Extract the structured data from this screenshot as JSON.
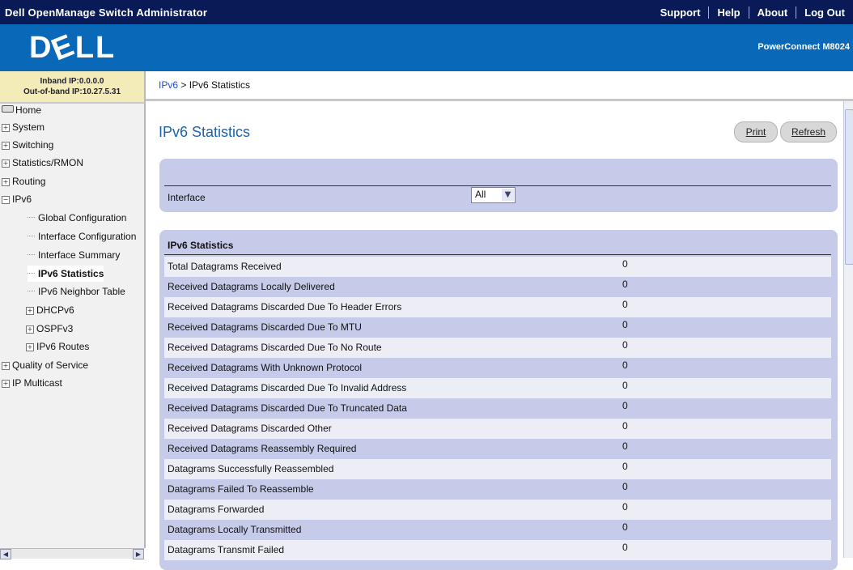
{
  "topbar": {
    "title": "Dell OpenManage Switch Administrator",
    "links": [
      "Support",
      "Help",
      "About",
      "Log Out"
    ]
  },
  "header": {
    "logo_left": "D",
    "logo_mid": "E",
    "logo_right": "LL",
    "product": "PowerConnect M8024"
  },
  "ipinfo": {
    "inband": "Inband IP:0.0.0.0",
    "outband": "Out-of-band IP:10.27.5.31"
  },
  "nav": {
    "home": "Home",
    "system": "System",
    "switching": "Switching",
    "statistics": "Statistics/RMON",
    "routing": "Routing",
    "ipv6": "IPv6",
    "global": "Global Configuration",
    "interface_cfg": "Interface Configuration",
    "interface_summary": "Interface Summary",
    "ipv6_statistics": "IPv6 Statistics",
    "neighbor": "IPv6 Neighbor Table",
    "dhcpv6": "DHCPv6",
    "ospfv3": "OSPFv3",
    "routes": "IPv6 Routes",
    "qos": "Quality of Service",
    "multicast": "IP Multicast"
  },
  "breadcrumb": {
    "link": "IPv6",
    "separator": " > ",
    "current": "IPv6 Statistics"
  },
  "main": {
    "title": "IPv6 Statistics",
    "print": "Print",
    "refresh": "Refresh",
    "interface_label": "Interface",
    "interface_value": "All",
    "stats_heading": "IPv6 Statistics"
  },
  "stats": [
    {
      "label": "Total Datagrams Received",
      "value": "0"
    },
    {
      "label": "Received Datagrams Locally Delivered",
      "value": "0"
    },
    {
      "label": "Received Datagrams Discarded Due To Header Errors",
      "value": "0"
    },
    {
      "label": "Received Datagrams Discarded Due To MTU",
      "value": "0"
    },
    {
      "label": "Received Datagrams Discarded Due To No Route",
      "value": "0"
    },
    {
      "label": "Received Datagrams With Unknown Protocol",
      "value": "0"
    },
    {
      "label": "Received Datagrams Discarded Due To Invalid Address",
      "value": "0"
    },
    {
      "label": "Received Datagrams Discarded Due To Truncated Data",
      "value": "0"
    },
    {
      "label": "Received Datagrams Discarded Other",
      "value": "0"
    },
    {
      "label": "Received Datagrams Reassembly Required",
      "value": "0"
    },
    {
      "label": "Datagrams Successfully Reassembled",
      "value": "0"
    },
    {
      "label": "Datagrams Failed To Reassemble",
      "value": "0"
    },
    {
      "label": "Datagrams Forwarded",
      "value": "0"
    },
    {
      "label": "Datagrams Locally Transmitted",
      "value": "0"
    },
    {
      "label": "Datagrams Transmit Failed",
      "value": "0"
    }
  ],
  "colors": {
    "topbar": "#0a1a57",
    "header": "#0a68b8",
    "panel": "#c6cbea",
    "title": "#1d62b0",
    "link": "#1f4ec2"
  }
}
